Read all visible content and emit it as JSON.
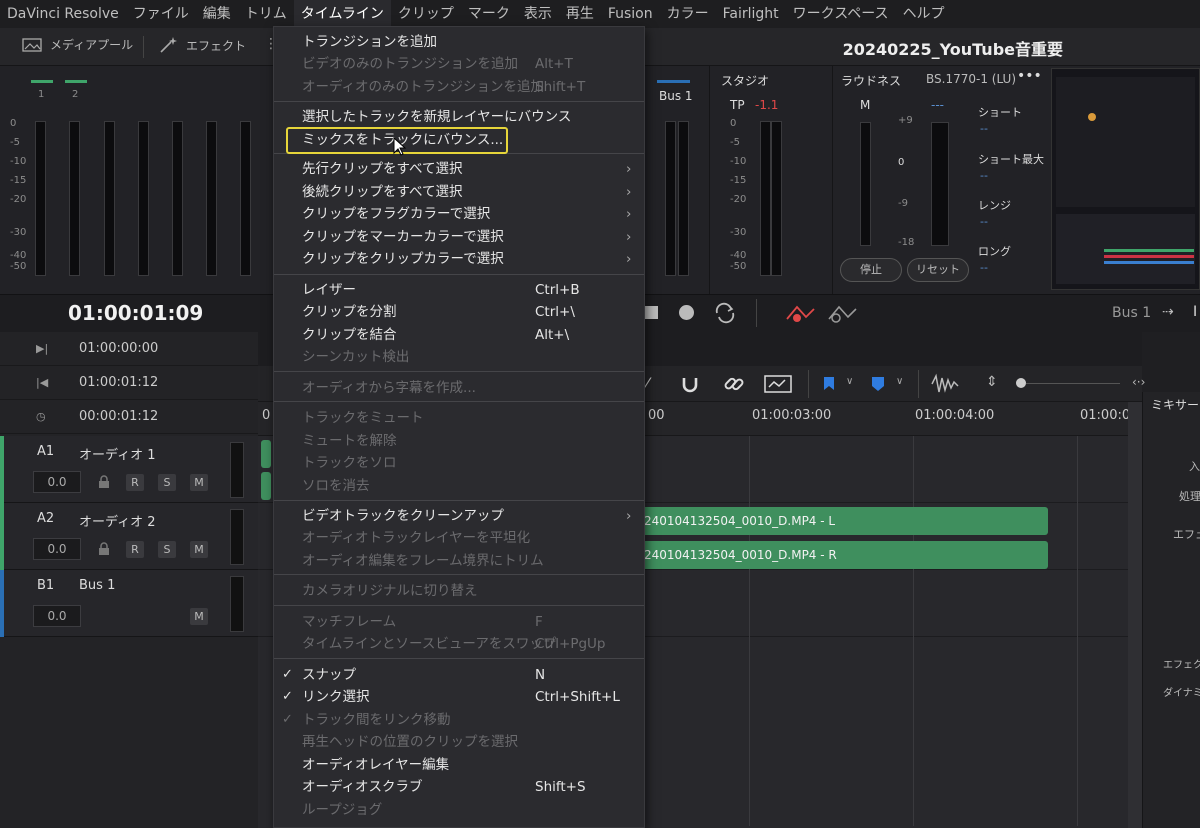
{
  "menubar": {
    "items": [
      "DaVinci Resolve",
      "ファイル",
      "編集",
      "トリム",
      "タイムライン",
      "クリップ",
      "マーク",
      "表示",
      "再生",
      "Fusion",
      "カラー",
      "Fairlight",
      "ワークスペース",
      "ヘルプ"
    ],
    "active_index": 4
  },
  "toolbar": {
    "media_pool": "メディアプール",
    "effects": "エフェクト",
    "project_title": "20240225_YouTube音重要"
  },
  "meters": {
    "channels": [
      "1",
      "2"
    ],
    "scale": [
      "0",
      "-5",
      "-10",
      "-15",
      "-20",
      "-30",
      "-40",
      "-50"
    ],
    "bus_label": "Bus 1",
    "studio": {
      "title": "スタジオ",
      "tp_label": "TP",
      "tp_value": "-1.1"
    },
    "loudness": {
      "title": "ラウドネス",
      "standard": "BS.1770-1 (LU)",
      "m_label": "M",
      "m_value": "---",
      "scale_right": [
        "+9",
        "0",
        "-9",
        "-18"
      ],
      "center_value": "0",
      "short": "ショート",
      "short_val": "--",
      "short_max": "ショート最大",
      "short_max_val": "--",
      "range": "レンジ",
      "range_val": "--",
      "long": "ロング",
      "long_val": "--",
      "stop": "停止",
      "reset": "リセット"
    }
  },
  "timecode": "01:00:01:09",
  "transport_bus": "Bus 1",
  "tc_rows": [
    {
      "value": "01:00:00:00"
    },
    {
      "value": "01:00:01:12"
    },
    {
      "value": "00:00:01:12"
    }
  ],
  "tracks": [
    {
      "id": "A1",
      "name": "オーディオ 1",
      "volume": "0.0",
      "color": "#3fa56a",
      "buttons": [
        "R",
        "S",
        "M"
      ]
    },
    {
      "id": "A2",
      "name": "オーディオ 2",
      "volume": "0.0",
      "color": "#3fa56a",
      "buttons": [
        "R",
        "S",
        "M"
      ]
    },
    {
      "id": "B1",
      "name": "Bus 1",
      "volume": "0.0",
      "color": "#2a6fb5",
      "buttons": [
        "M"
      ]
    }
  ],
  "ruler": {
    "labels": [
      "0",
      "00",
      "01:00:03:00",
      "01:00:04:00",
      "01:00:0"
    ]
  },
  "clips": {
    "left": "240104132504_0010_D.MP4 - L",
    "right": "240104132504_0010_D.MP4 - R"
  },
  "mixer": {
    "title": "ミキサー",
    "labels": [
      "入",
      "処理",
      "エフェク",
      "エフェクト",
      "ダイナミク"
    ]
  },
  "menu": {
    "items": [
      {
        "label": "トランジションを追加",
        "shortcut": "",
        "enabled": true
      },
      {
        "label": "ビデオのみのトランジションを追加",
        "shortcut": "Alt+T",
        "enabled": false
      },
      {
        "label": "オーディオのみのトランジションを追加",
        "shortcut": "Shift+T",
        "enabled": false
      },
      {
        "label": "選択したトラックを新規レイヤーにバウンス",
        "shortcut": "",
        "enabled": true
      },
      {
        "label": "ミックスをトラックにバウンス...",
        "shortcut": "",
        "enabled": true
      },
      {
        "label": "先行クリップをすべて選択",
        "shortcut": "",
        "enabled": true,
        "submenu": true
      },
      {
        "label": "後続クリップをすべて選択",
        "shortcut": "",
        "enabled": true,
        "submenu": true
      },
      {
        "label": "クリップをフラグカラーで選択",
        "shortcut": "",
        "enabled": true,
        "submenu": true
      },
      {
        "label": "クリップをマーカーカラーで選択",
        "shortcut": "",
        "enabled": true,
        "submenu": true
      },
      {
        "label": "クリップをクリップカラーで選択",
        "shortcut": "",
        "enabled": true,
        "submenu": true
      },
      {
        "label": "レイザー",
        "shortcut": "Ctrl+B",
        "enabled": true
      },
      {
        "label": "クリップを分割",
        "shortcut": "Ctrl+\\",
        "enabled": true
      },
      {
        "label": "クリップを結合",
        "shortcut": "Alt+\\",
        "enabled": true
      },
      {
        "label": "シーンカット検出",
        "shortcut": "",
        "enabled": false
      },
      {
        "label": "オーディオから字幕を作成...",
        "shortcut": "",
        "enabled": false
      },
      {
        "label": "トラックをミュート",
        "shortcut": "",
        "enabled": false
      },
      {
        "label": "ミュートを解除",
        "shortcut": "",
        "enabled": false
      },
      {
        "label": "トラックをソロ",
        "shortcut": "",
        "enabled": false
      },
      {
        "label": "ソロを消去",
        "shortcut": "",
        "enabled": false
      },
      {
        "label": "ビデオトラックをクリーンアップ",
        "shortcut": "",
        "enabled": true,
        "submenu": true
      },
      {
        "label": "オーディオトラックレイヤーを平坦化",
        "shortcut": "",
        "enabled": false
      },
      {
        "label": "オーディオ編集をフレーム境界にトリム",
        "shortcut": "",
        "enabled": false
      },
      {
        "label": "カメラオリジナルに切り替え",
        "shortcut": "",
        "enabled": false
      },
      {
        "label": "マッチフレーム",
        "shortcut": "F",
        "enabled": false
      },
      {
        "label": "タイムラインとソースビューアをスワップ",
        "shortcut": "Ctrl+PgUp",
        "enabled": false
      },
      {
        "label": "スナップ",
        "shortcut": "N",
        "enabled": true,
        "checked": true
      },
      {
        "label": "リンク選択",
        "shortcut": "Ctrl+Shift+L",
        "enabled": true,
        "checked": true
      },
      {
        "label": "トラック間をリンク移動",
        "shortcut": "",
        "enabled": false,
        "checked": true
      },
      {
        "label": "再生ヘッドの位置のクリップを選択",
        "shortcut": "",
        "enabled": false
      },
      {
        "label": "オーディオレイヤー編集",
        "shortcut": "",
        "enabled": true
      },
      {
        "label": "オーディオスクラブ",
        "shortcut": "Shift+S",
        "enabled": true
      },
      {
        "label": "ループジョグ",
        "shortcut": "",
        "enabled": false
      }
    ],
    "highlight_index": 4,
    "highlight_color": "#e6d53a"
  },
  "colors": {
    "accent_green": "#3fa56a",
    "bus_blue": "#2a6fb5",
    "highlight": "#e6d53a"
  }
}
